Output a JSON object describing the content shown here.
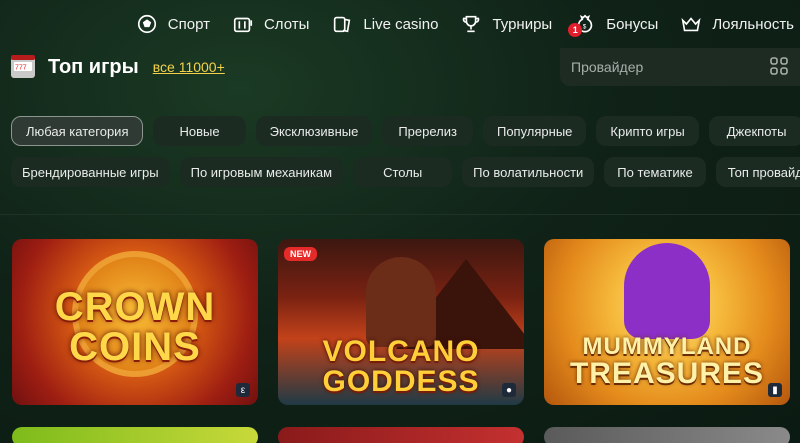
{
  "nav": {
    "items": [
      {
        "label": "Спорт",
        "icon": "soccer-ball-icon"
      },
      {
        "label": "Слоты",
        "icon": "slots-icon"
      },
      {
        "label": "Live casino",
        "icon": "cards-icon"
      },
      {
        "label": "Турниры",
        "icon": "trophy-icon"
      },
      {
        "label": "Бонусы",
        "icon": "money-bag-icon",
        "badge": "1"
      },
      {
        "label": "Лояльность",
        "icon": "crown-icon"
      }
    ]
  },
  "section": {
    "title": "Топ игры",
    "see_all": "все 11000+",
    "provider_placeholder": "Провайдер"
  },
  "categories_row1": [
    "Любая категория",
    "Новые",
    "Эксклюзивные",
    "Пререлиз",
    "Популярные",
    "Крипто игры",
    "Джекпоты"
  ],
  "categories_row2": [
    "Брендированные игры",
    "По игровым механикам",
    "Столы",
    "По волатильности",
    "По тематике",
    "Топ провайд"
  ],
  "active_category": "Любая категория",
  "games": [
    {
      "title": "CROWN COINS",
      "art_line1": "CROWN",
      "art_line2": "COINS"
    },
    {
      "title": "VOLCANO GODDESS",
      "art_line1": "VOLCANO",
      "art_line2": "GODDESS",
      "badge": "NEW"
    },
    {
      "title": "MUMMYLAND TREASURES",
      "art_line1": "MUMMYLAND",
      "art_line2": "TREASURES"
    }
  ],
  "colors": {
    "accent_link": "#f3d24a",
    "badge_red": "#e01e2c",
    "chip_bg": "#1c2b22"
  }
}
